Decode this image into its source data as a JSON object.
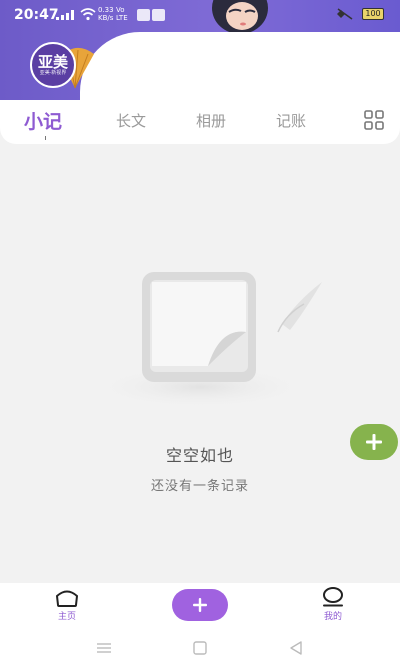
{
  "status_bar": {
    "time": "20:47",
    "speed_top": "0.33",
    "speed_bottom": "KB/s",
    "net_top": "Vo",
    "net_bottom": "LTE",
    "battery": "100"
  },
  "logo": {
    "main": "亚美",
    "sub": "亚美·新视界"
  },
  "tabs": {
    "items": [
      {
        "label": "小记",
        "active": true
      },
      {
        "label": "长文",
        "active": false
      },
      {
        "label": "相册",
        "active": false
      },
      {
        "label": "记账",
        "active": false
      }
    ],
    "grid_icon": "grid-icon"
  },
  "empty_state": {
    "title": "空空如也",
    "subtitle": "还没有一条记录"
  },
  "bottom_nav": {
    "home_label": "主页",
    "mine_label": "我的"
  },
  "colors": {
    "header_purple": "#7462cf",
    "accent_purple": "#8e5bd2",
    "fab_green": "#86b34d",
    "center_add_purple": "#a062e0"
  }
}
